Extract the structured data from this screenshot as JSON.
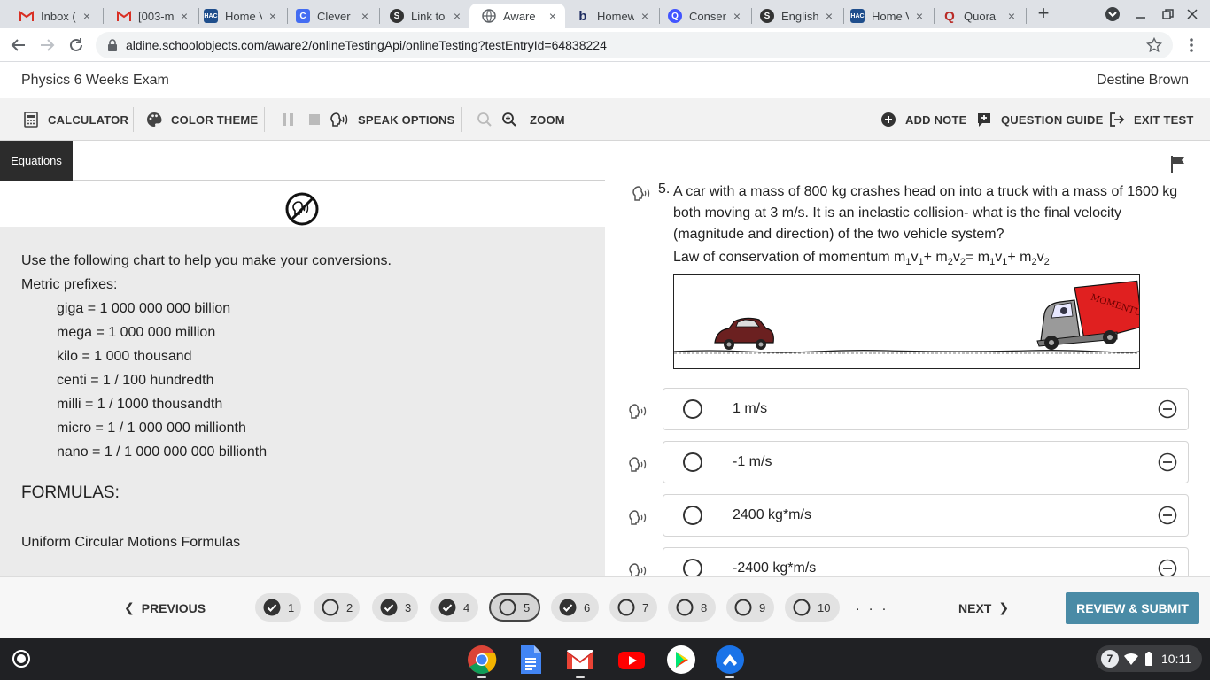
{
  "browser": {
    "tabs": [
      {
        "label": "Inbox (",
        "icon": "gmail-icon"
      },
      {
        "label": "[003-m",
        "icon": "gmail-icon"
      },
      {
        "label": "Home V",
        "icon": "hac-icon"
      },
      {
        "label": "Clever |",
        "icon": "clever-icon"
      },
      {
        "label": "Link to",
        "icon": "schoology-icon"
      },
      {
        "label": "Aware",
        "icon": "globe-icon"
      },
      {
        "label": "Homew",
        "icon": "brainly-icon"
      },
      {
        "label": "Conser",
        "icon": "quizlet-icon"
      },
      {
        "label": "English",
        "icon": "schoology-icon"
      },
      {
        "label": "Home V",
        "icon": "hac-icon"
      },
      {
        "label": "Quora",
        "icon": "quora-icon"
      }
    ],
    "active_tab_index": 5,
    "url": "aldine.schoolobjects.com/aware2/onlineTestingApi/onlineTesting?testEntryId=64838224"
  },
  "app": {
    "title": "Physics 6 Weeks Exam",
    "user": "Destine Brown"
  },
  "toolbar": {
    "calculator": "CALCULATOR",
    "color_theme": "COLOR THEME",
    "speak_options": "SPEAK OPTIONS",
    "zoom": "ZOOM",
    "add_note": "ADD NOTE",
    "question_guide": "QUESTION GUIDE",
    "exit_test": "EXIT TEST"
  },
  "equations": {
    "tab_label": "Equations",
    "intro": "Use the following chart to help you make your conversions.",
    "prefixes_heading": "Metric prefixes:",
    "prefixes": [
      "giga = 1 000 000 000 billion",
      "mega = 1 000 000 million",
      "kilo = 1 000 thousand",
      "centi = 1 / 100 hundredth",
      "milli = 1 / 1000 thousandth",
      "micro = 1 / 1 000 000 millionth",
      "nano = 1 / 1 000 000 000 billionth"
    ],
    "formulas_heading": "FORMULAS:",
    "section_heading": "Uniform Circular Motions Formulas"
  },
  "question": {
    "number": "5.",
    "text": "A car with a mass of 800 kg crashes head on into a truck with a mass of 1600 kg both moving at 3 m/s.  It is an inelastic collision- what is the final velocity (magnitude and direction) of the two vehicle system?",
    "law_prefix": "Law of conservation of momentum ",
    "image_text": "MOMENTUM TRANSFER",
    "options": [
      "1 m/s",
      "-1 m/s",
      "2400 kg*m/s",
      "-2400 kg*m/s"
    ]
  },
  "nav": {
    "previous": "PREVIOUS",
    "next": "NEXT",
    "review_submit": "REVIEW & SUBMIT",
    "ellipsis": ". . .",
    "questions": [
      {
        "label": "1",
        "status": "answered"
      },
      {
        "label": "2",
        "status": "unanswered"
      },
      {
        "label": "3",
        "status": "answered"
      },
      {
        "label": "4",
        "status": "answered"
      },
      {
        "label": "5",
        "status": "current"
      },
      {
        "label": "6",
        "status": "answered"
      },
      {
        "label": "7",
        "status": "unanswered"
      },
      {
        "label": "8",
        "status": "unanswered"
      },
      {
        "label": "9",
        "status": "unanswered"
      },
      {
        "label": "10",
        "status": "unanswered"
      }
    ]
  },
  "shelf": {
    "apps": [
      "chrome-icon",
      "docs-icon",
      "gmail-icon",
      "youtube-icon",
      "play-store-icon",
      "files-icon"
    ],
    "notification_count": "7",
    "time": "10:11"
  },
  "colors": {
    "accent": "#4a8ba6",
    "panel_gray": "#ebebeb",
    "truck_red": "#e02020"
  }
}
